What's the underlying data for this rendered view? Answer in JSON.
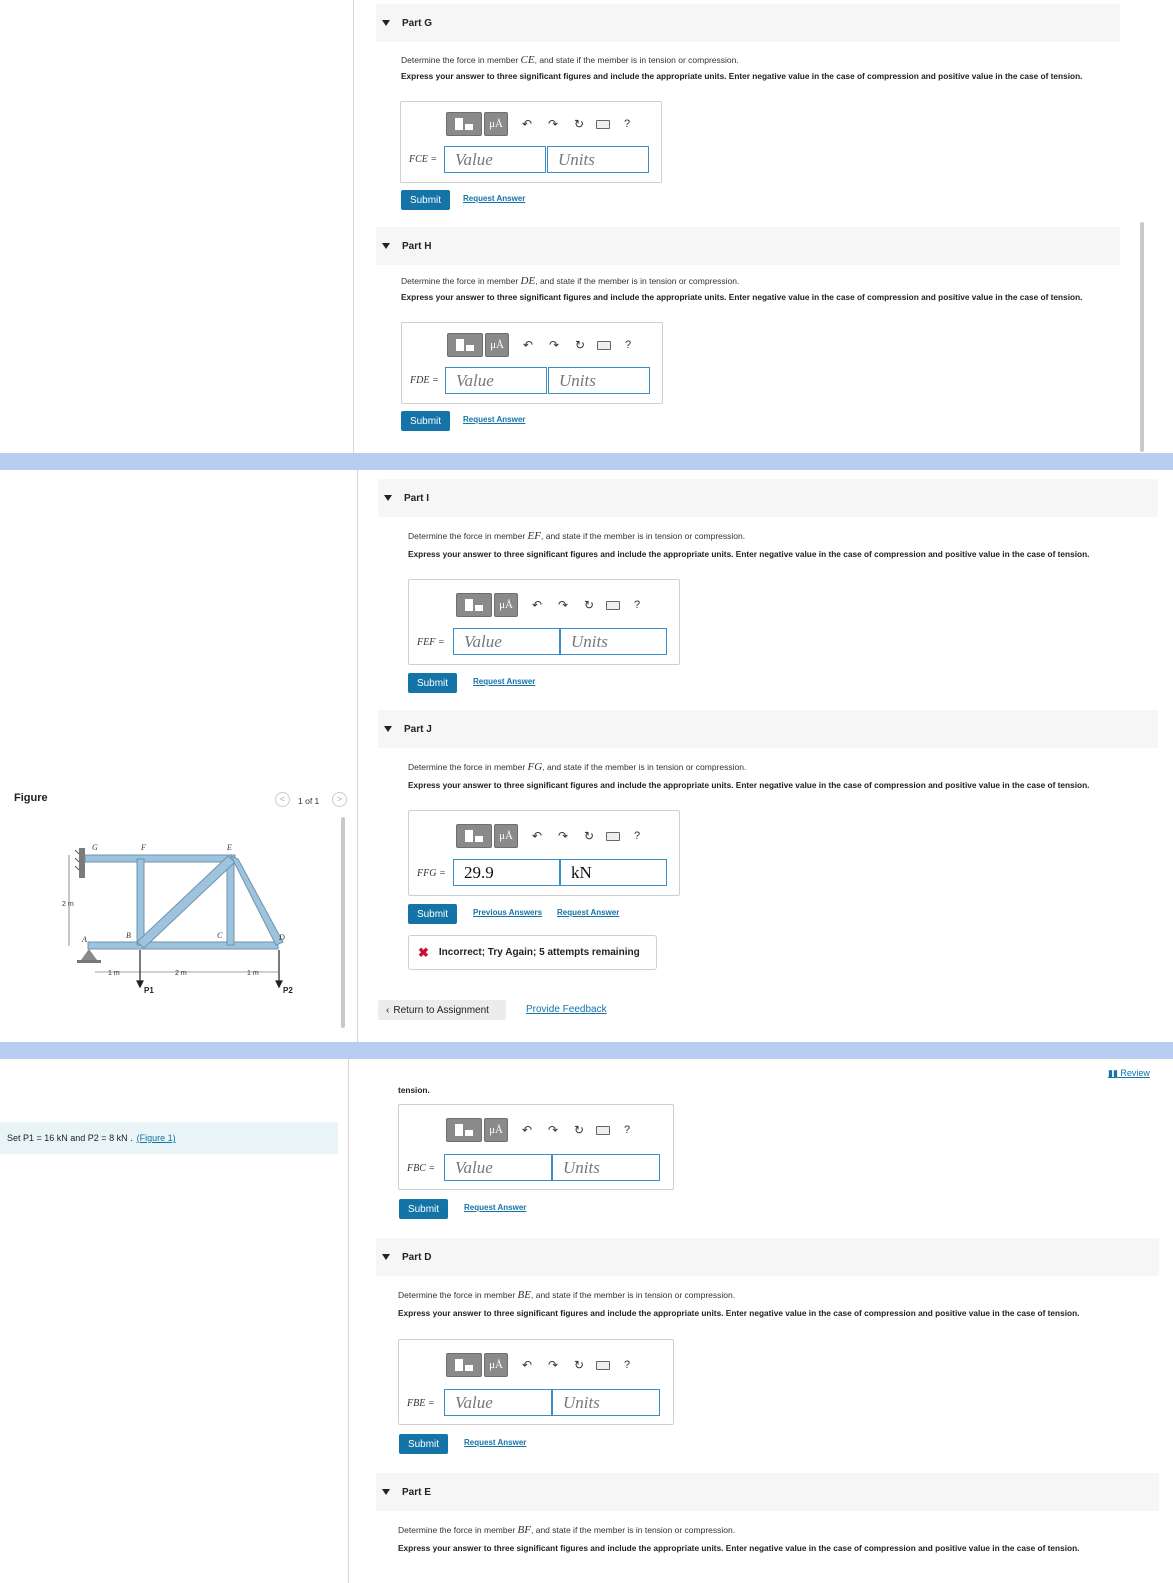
{
  "labels": {
    "question_prefix": "Determine the force in member",
    "question_suffix": ", and state if the member is in tension or compression.",
    "instruction": "Express your answer to three significant figures and include the appropriate units. Enter negative value in the case of compression and positive value in the case of tension.",
    "value_placeholder": "Value",
    "units_placeholder": "Units",
    "submit": "Submit",
    "request_answer": "Request Answer",
    "previous_answers": "Previous Answers",
    "mu_button": "μÅ",
    "help": "?"
  },
  "parts": {
    "G": {
      "title": "Part G",
      "member": "CE",
      "var": "FCE ="
    },
    "H": {
      "title": "Part H",
      "member": "DE",
      "var": "FDE ="
    },
    "I": {
      "title": "Part I",
      "member": "EF",
      "var": "FEF ="
    },
    "J": {
      "title": "Part J",
      "member": "FG",
      "var": "FFG =",
      "value": "29.9",
      "units": "kN",
      "feedback": "Incorrect; Try Again; 5 attempts remaining"
    },
    "C": {
      "var": "FBC =",
      "tension_tail": "tension."
    },
    "D": {
      "title": "Part D",
      "member": "BE",
      "var": "FBE ="
    },
    "E": {
      "title": "Part E",
      "member": "BF"
    }
  },
  "figure": {
    "label": "Figure",
    "pager": "1 of 1",
    "joints": {
      "G": "G",
      "F": "F",
      "E": "E",
      "A": "A",
      "B": "B",
      "C": "C",
      "D": "D"
    },
    "height_dim": "2 m",
    "span_dims": [
      "1 m",
      "2 m",
      "1 m"
    ],
    "loads": [
      "P1",
      "P2"
    ]
  },
  "nav": {
    "return": "Return to Assignment",
    "feedback": "Provide Feedback",
    "review": "Review"
  },
  "problem": {
    "statement": "Set P1 = 16 kN and P2 = 8 kN .",
    "figure_link": "(Figure 1)"
  },
  "colors": {
    "accent": "#1474a8",
    "band": "#b9cdf0",
    "truss": "#9ec3dc",
    "error": "#c8102e"
  }
}
